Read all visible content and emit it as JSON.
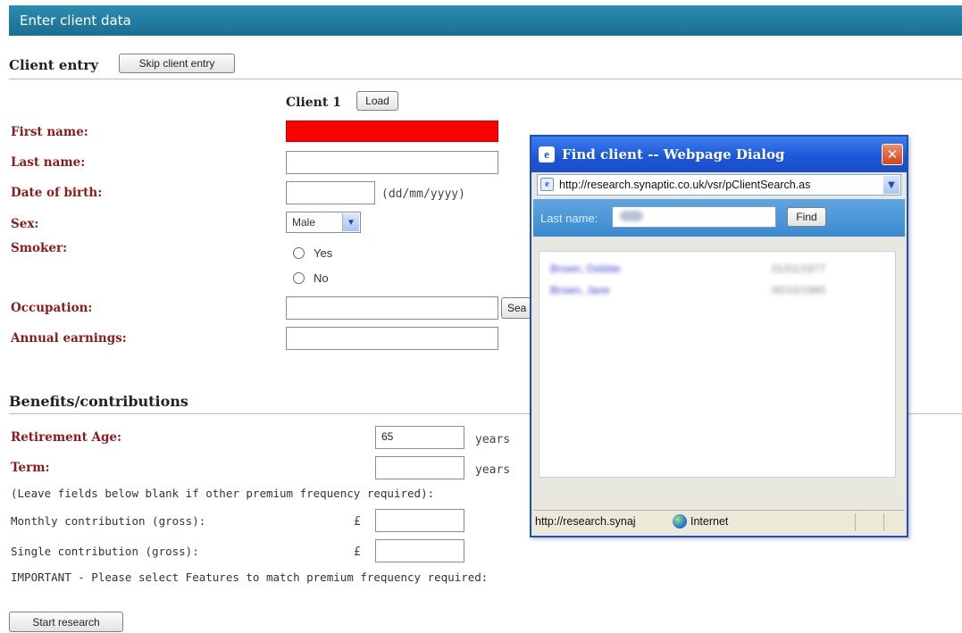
{
  "header": {
    "title": "Enter client data"
  },
  "client_entry": {
    "title": "Client entry",
    "skip_button": "Skip client entry",
    "client_heading": "Client 1",
    "load_button": "Load"
  },
  "form": {
    "first_name_label": "First name:",
    "first_name_value": "",
    "last_name_label": "Last name:",
    "last_name_value": "",
    "dob_label": "Date of birth:",
    "dob_value": "",
    "dob_hint": "(dd/mm/yyyy)",
    "sex_label": "Sex:",
    "sex_value": "Male",
    "smoker_label": "Smoker:",
    "smoker_yes": "Yes",
    "smoker_no": "No",
    "occupation_label": "Occupation:",
    "occupation_value": "",
    "occupation_search_button": "Sea",
    "earnings_label": "Annual earnings:",
    "earnings_value": ""
  },
  "benefits": {
    "title": "Benefits/contributions",
    "retirement_label": "Retirement Age:",
    "retirement_value": "65",
    "retirement_unit": "years",
    "term_label": "Term:",
    "term_value": "",
    "term_unit": "years",
    "note": "(Leave fields below blank if other premium frequency required):",
    "monthly_label": "Monthly contribution (gross):",
    "monthly_currency": "£",
    "single_label": "Single contribution (gross):",
    "single_currency": "£",
    "important_note": "IMPORTANT - Please select Features to match premium frequency required:",
    "start_button": "Start research"
  },
  "dialog": {
    "title": "Find client -- Webpage Dialog",
    "url": "http://research.synaptic.co.uk/vsr/pClientSearch.as",
    "search_label": "Last name:",
    "find_button": "Find",
    "status_url": "http://research.synaj",
    "zone": "Internet"
  },
  "colors": {
    "header_bg": "#1a6f92",
    "label_red": "#8b1a1a",
    "required_field": "#ff0000",
    "dialog_title_bg": "#1b55d6"
  }
}
